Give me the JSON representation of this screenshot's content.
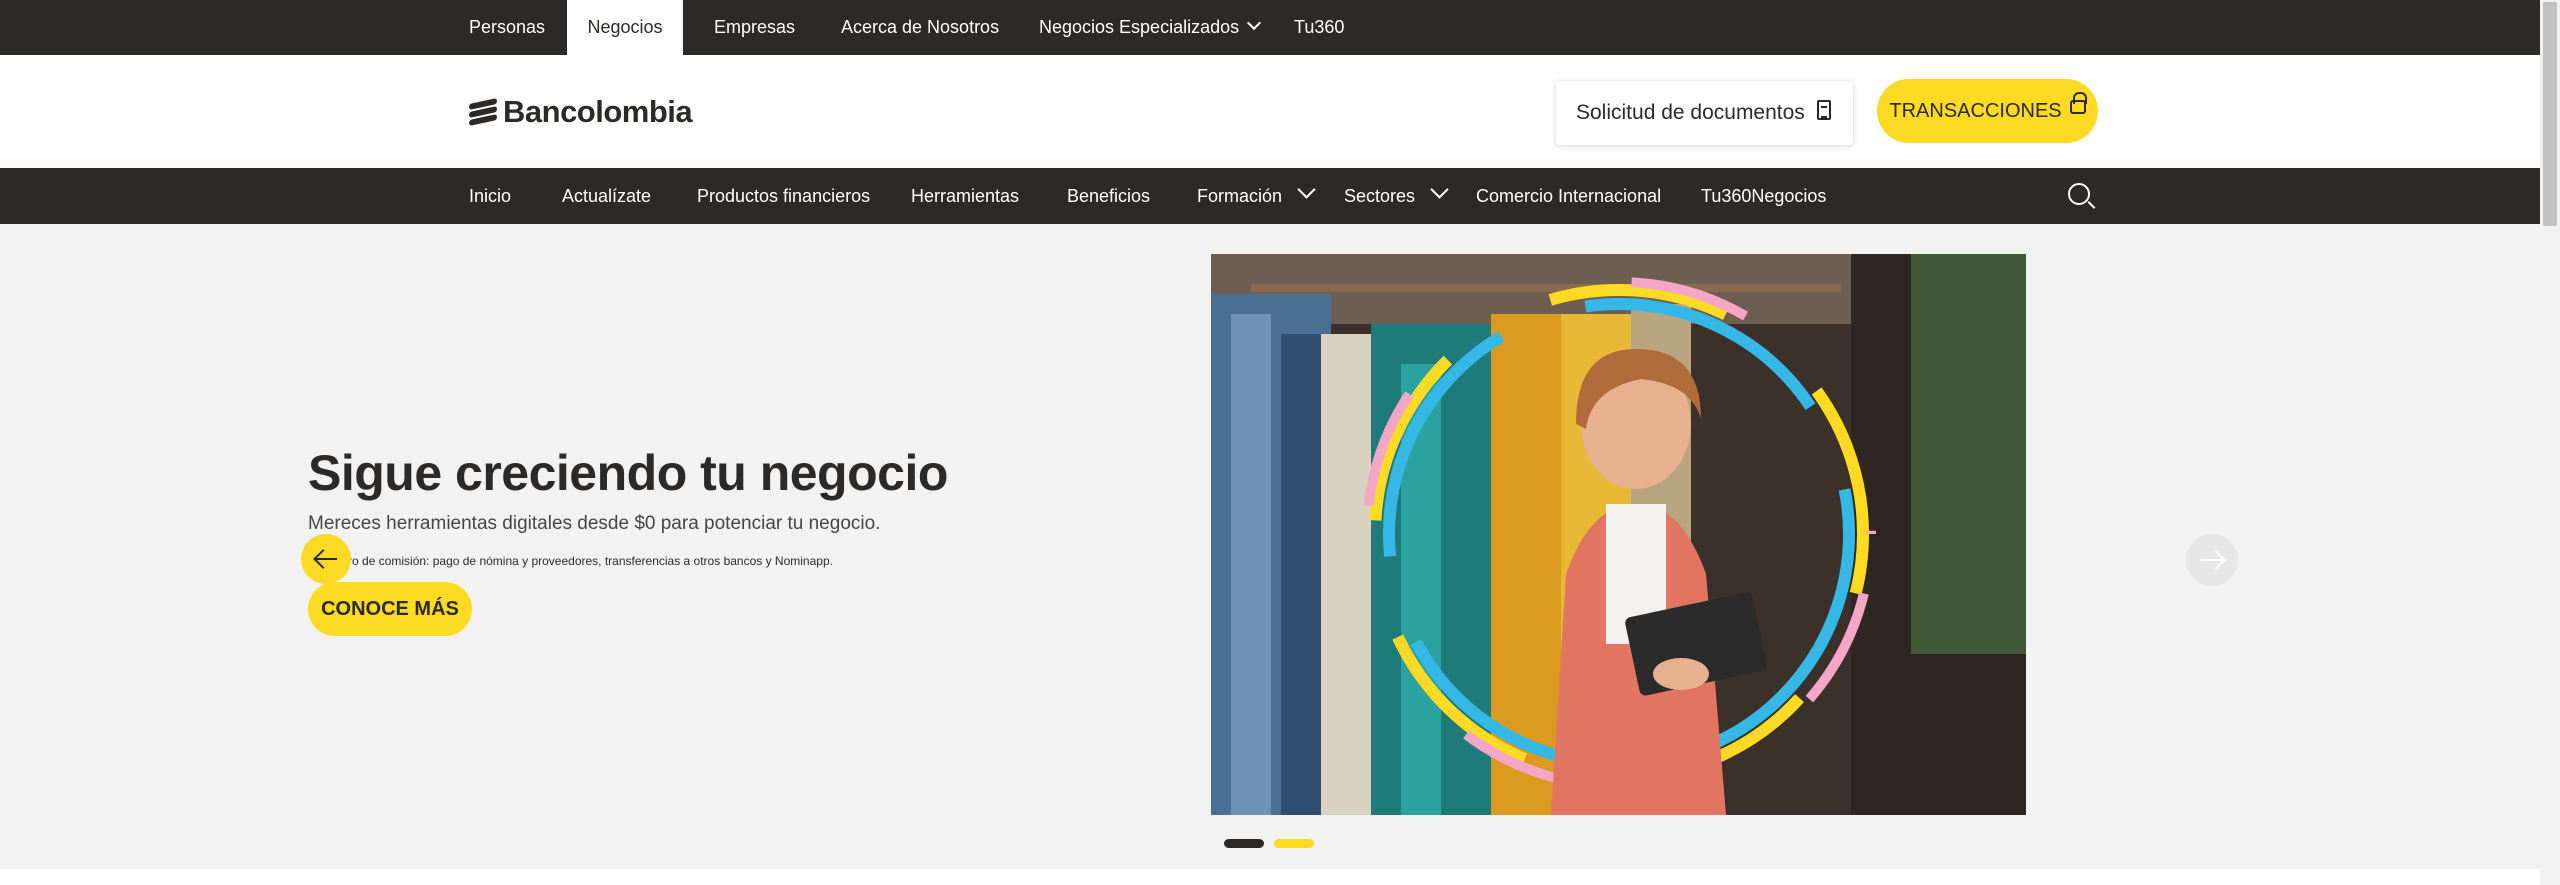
{
  "segment_nav": {
    "items": [
      {
        "label": "Personas",
        "active": false
      },
      {
        "label": "Negocios",
        "active": true
      },
      {
        "label": "Empresas",
        "active": false
      },
      {
        "label": "Acerca de Nosotros",
        "active": false
      },
      {
        "label": "Negocios Especializados",
        "active": false,
        "dropdown": true
      },
      {
        "label": "Tu360",
        "active": false
      }
    ]
  },
  "header": {
    "logo_text": "Bancolombia",
    "documents_button": "Solicitud de documentos",
    "documents_icon": "document-icon",
    "transactions_button": "TRANSACCIONES",
    "transactions_icon": "lock-icon"
  },
  "main_nav": {
    "items": [
      {
        "label": "Inicio"
      },
      {
        "label": "Actualízate"
      },
      {
        "label": "Productos financieros"
      },
      {
        "label": "Herramientas"
      },
      {
        "label": "Beneficios"
      },
      {
        "label": "Formación",
        "dropdown": true
      },
      {
        "label": "Sectores",
        "dropdown": true
      },
      {
        "label": "Comercio Internacional"
      },
      {
        "label": "Tu360Negocios"
      }
    ],
    "search_icon": "search-icon"
  },
  "hero": {
    "title": "Sigue creciendo tu negocio",
    "subtitle": "Mereces herramientas digitales desde $0 para potenciar tu negocio.",
    "footnote": "Sin cobro de comisión: pago de nómina y proveedores, transferencias a otros bancos y Nominapp.",
    "cta": "CONOCE MÁS",
    "prev_icon": "arrow-left-icon",
    "next_icon": "arrow-right-icon",
    "slides": [
      {
        "active": false
      },
      {
        "active": true
      }
    ]
  },
  "colors": {
    "brand_yellow": "#FDDA24",
    "dark": "#2C2A29",
    "background": "#F2F2F2"
  }
}
